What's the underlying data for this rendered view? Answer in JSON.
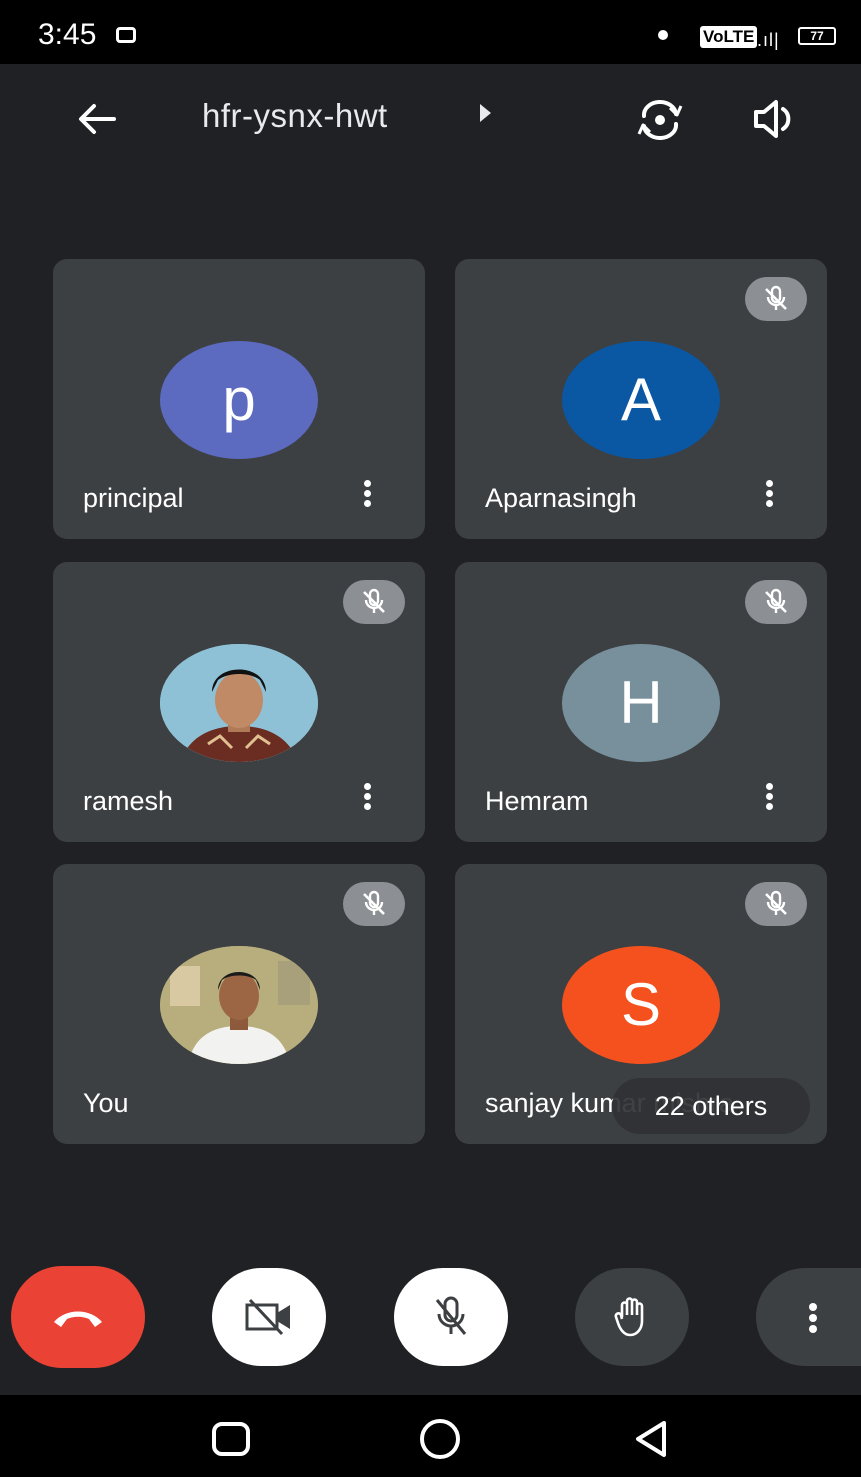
{
  "status_bar": {
    "time": "3:45",
    "network": "VoLTE",
    "signal": ".ıl|",
    "battery": "77"
  },
  "header": {
    "meeting_code": "hfr-ysnx-hwt"
  },
  "participants": [
    {
      "name": "principal",
      "initial": "p",
      "avatar_color": "#5c6bc0",
      "muted": false,
      "photo": false
    },
    {
      "name": "Aparnasingh",
      "initial": "A",
      "avatar_color": "#0a57a4",
      "muted": true,
      "photo": false
    },
    {
      "name": "ramesh",
      "initial": "",
      "avatar_color": "#88b4c8",
      "muted": true,
      "photo": true
    },
    {
      "name": "Hemram",
      "initial": "H",
      "avatar_color": "#78909c",
      "muted": true,
      "photo": false
    },
    {
      "name": "You",
      "initial": "",
      "avatar_color": "#b5a97a",
      "muted": true,
      "photo": true
    },
    {
      "name": "sanjay kumar mishra",
      "initial": "S",
      "avatar_color": "#f4511e",
      "muted": true,
      "photo": false
    }
  ],
  "others_pill": "22 others",
  "colors": {
    "background": "#202124",
    "tile": "#3c4043",
    "end_call": "#ea4335",
    "control_active": "#ffffff",
    "control_inactive": "#3c4043"
  },
  "controls": [
    "end-call",
    "camera-off",
    "microphone-off",
    "raise-hand",
    "more-options"
  ]
}
